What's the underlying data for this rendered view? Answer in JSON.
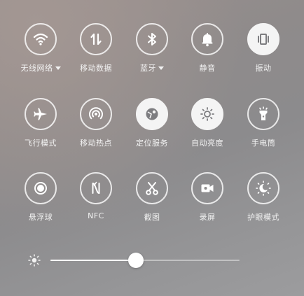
{
  "quick_settings": {
    "row1": [
      {
        "label": "无线网络",
        "icon": "wifi-icon",
        "active": false,
        "has_dropdown": true
      },
      {
        "label": "移动数据",
        "icon": "mobile-data-icon",
        "active": false,
        "has_dropdown": false
      },
      {
        "label": "蓝牙",
        "icon": "bluetooth-icon",
        "active": false,
        "has_dropdown": true
      },
      {
        "label": "静音",
        "icon": "bell-icon",
        "active": false,
        "has_dropdown": false
      },
      {
        "label": "振动",
        "icon": "vibrate-icon",
        "active": true,
        "has_dropdown": false
      }
    ],
    "row2": [
      {
        "label": "飞行模式",
        "icon": "airplane-icon",
        "active": false
      },
      {
        "label": "移动热点",
        "icon": "hotspot-icon",
        "active": false
      },
      {
        "label": "定位服务",
        "icon": "location-icon",
        "active": true
      },
      {
        "label": "自动亮度",
        "icon": "auto-brightness-icon",
        "active": true
      },
      {
        "label": "手电筒",
        "icon": "flashlight-icon",
        "active": false
      }
    ],
    "row3": [
      {
        "label": "悬浮球",
        "icon": "floating-ball-icon",
        "active": false
      },
      {
        "label": "NFC",
        "icon": "nfc-icon",
        "active": false
      },
      {
        "label": "截图",
        "icon": "scissors-icon",
        "active": false
      },
      {
        "label": "录屏",
        "icon": "screen-record-icon",
        "active": false
      },
      {
        "label": "护眼模式",
        "icon": "eye-care-icon",
        "active": false
      }
    ]
  },
  "brightness": {
    "icon": "brightness-sun-icon",
    "level": 0.45
  },
  "colors": {
    "icon_on_dark": "#ffffff",
    "icon_on_light": "#7d7d80",
    "active_fill": "#f4f4f4"
  }
}
